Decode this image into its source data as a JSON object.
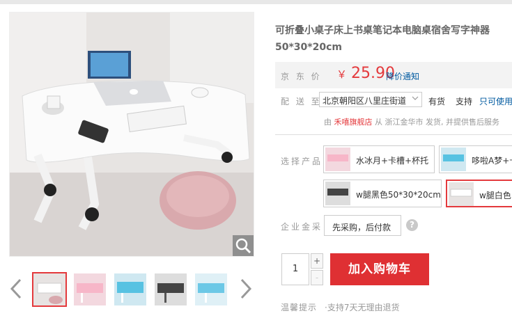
{
  "product": {
    "title": "可折叠小桌子床上书桌笔记本电脑桌宿舍写字神器",
    "subtitle": "50*30*20cm"
  },
  "price": {
    "label": "京 东 价",
    "currency": "￥",
    "value": "25.90",
    "notify": "降价通知"
  },
  "shipping": {
    "label": "配 送 至",
    "address": "北京朝阳区八里庄街道",
    "stock": "有货",
    "support": "支持",
    "only_use": "只可使用",
    "from_prefix": "由",
    "shop": "禾嘻旗舰店",
    "from_suffix": "从 浙江金华市 发货, 并提供售后服务"
  },
  "options": {
    "label": "选择产品",
    "items": [
      {
        "text": "水冰月+卡槽+杯托"
      },
      {
        "text": "哆啦A梦+卡槽"
      },
      {
        "text": "w腿黑色50*30*20cm"
      },
      {
        "text": "w腿白色"
      }
    ]
  },
  "enterprise": {
    "label": "企业金采",
    "button": "先采购，后付款",
    "help": "?"
  },
  "purchase": {
    "quantity": "1",
    "plus": "+",
    "minus": "-",
    "cart_button": "加入购物车"
  },
  "tips": {
    "label": "温馨提示",
    "text": "·支持7天无理由退货"
  },
  "icons": {
    "zoom": "magnifier-icon",
    "prev": "chevron-left-icon",
    "next": "chevron-right-icon",
    "dropdown": "chevron-down-icon"
  },
  "colors": {
    "accent": "#e4393c",
    "cart": "#df3033",
    "link": "#005aa0"
  }
}
